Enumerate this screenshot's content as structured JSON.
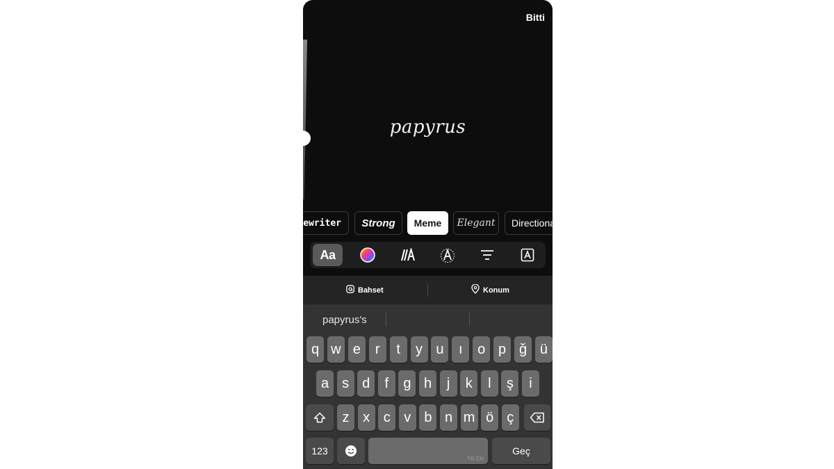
{
  "header": {
    "done_label": "Bitti"
  },
  "canvas": {
    "text": "papyrus"
  },
  "fonts": [
    {
      "label": "Typewriter",
      "visible": "ewriter"
    },
    {
      "label": "Strong"
    },
    {
      "label": "Meme",
      "selected": true
    },
    {
      "label": "Elegant"
    },
    {
      "label": "Directional"
    }
  ],
  "tools": [
    {
      "name": "font-style",
      "label": "Aa",
      "active": true
    },
    {
      "name": "color-wheel"
    },
    {
      "name": "animation"
    },
    {
      "name": "text-effect"
    },
    {
      "name": "alignment"
    },
    {
      "name": "background"
    }
  ],
  "mention_bar": {
    "mention_label": "Bahset",
    "location_label": "Konum"
  },
  "keyboard": {
    "suggestions": [
      "papyrus's",
      "",
      ""
    ],
    "row1": [
      "q",
      "w",
      "e",
      "r",
      "t",
      "y",
      "u",
      "ı",
      "o",
      "p",
      "ğ",
      "ü"
    ],
    "row2": [
      "a",
      "s",
      "d",
      "f",
      "g",
      "h",
      "j",
      "k",
      "l",
      "ş",
      "i"
    ],
    "row3": [
      "z",
      "x",
      "c",
      "v",
      "b",
      "n",
      "m",
      "ö",
      "ç"
    ],
    "numbers_label": "123",
    "space_label": "TR EN",
    "return_label": "Geç"
  }
}
